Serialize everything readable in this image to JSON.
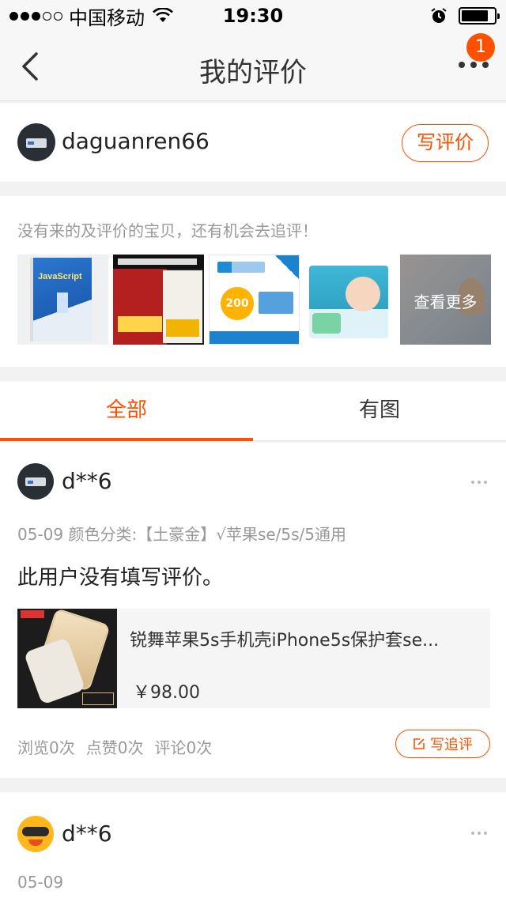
{
  "status_bar": {
    "carrier": "中国移动",
    "time": "19:30"
  },
  "nav": {
    "title": "我的评价",
    "badge": "1"
  },
  "user": {
    "name": "daguanren66",
    "write_review": "写评价"
  },
  "pending": {
    "hint": "没有来的及评价的宝贝，还有机会去追评！",
    "see_more": "查看更多"
  },
  "tabs": [
    {
      "label": "全部",
      "active": true
    },
    {
      "label": "有图",
      "active": false
    }
  ],
  "reviews": [
    {
      "user": "d**6",
      "meta": "05-09 颜色分类:【土豪金】√苹果se/5s/5通用",
      "text": "此用户没有填写评价。",
      "product": {
        "title": "锐舞苹果5s手机壳iPhone5s保护套se...",
        "price": "￥98.00"
      },
      "stats": {
        "views": "浏览0次",
        "likes": "点赞0次",
        "comments": "评论0次"
      },
      "followup": "写追评"
    },
    {
      "user": "d**6",
      "meta": "05-09"
    }
  ],
  "colors": {
    "accent": "#ff5000",
    "secondary_text": "#999999"
  }
}
